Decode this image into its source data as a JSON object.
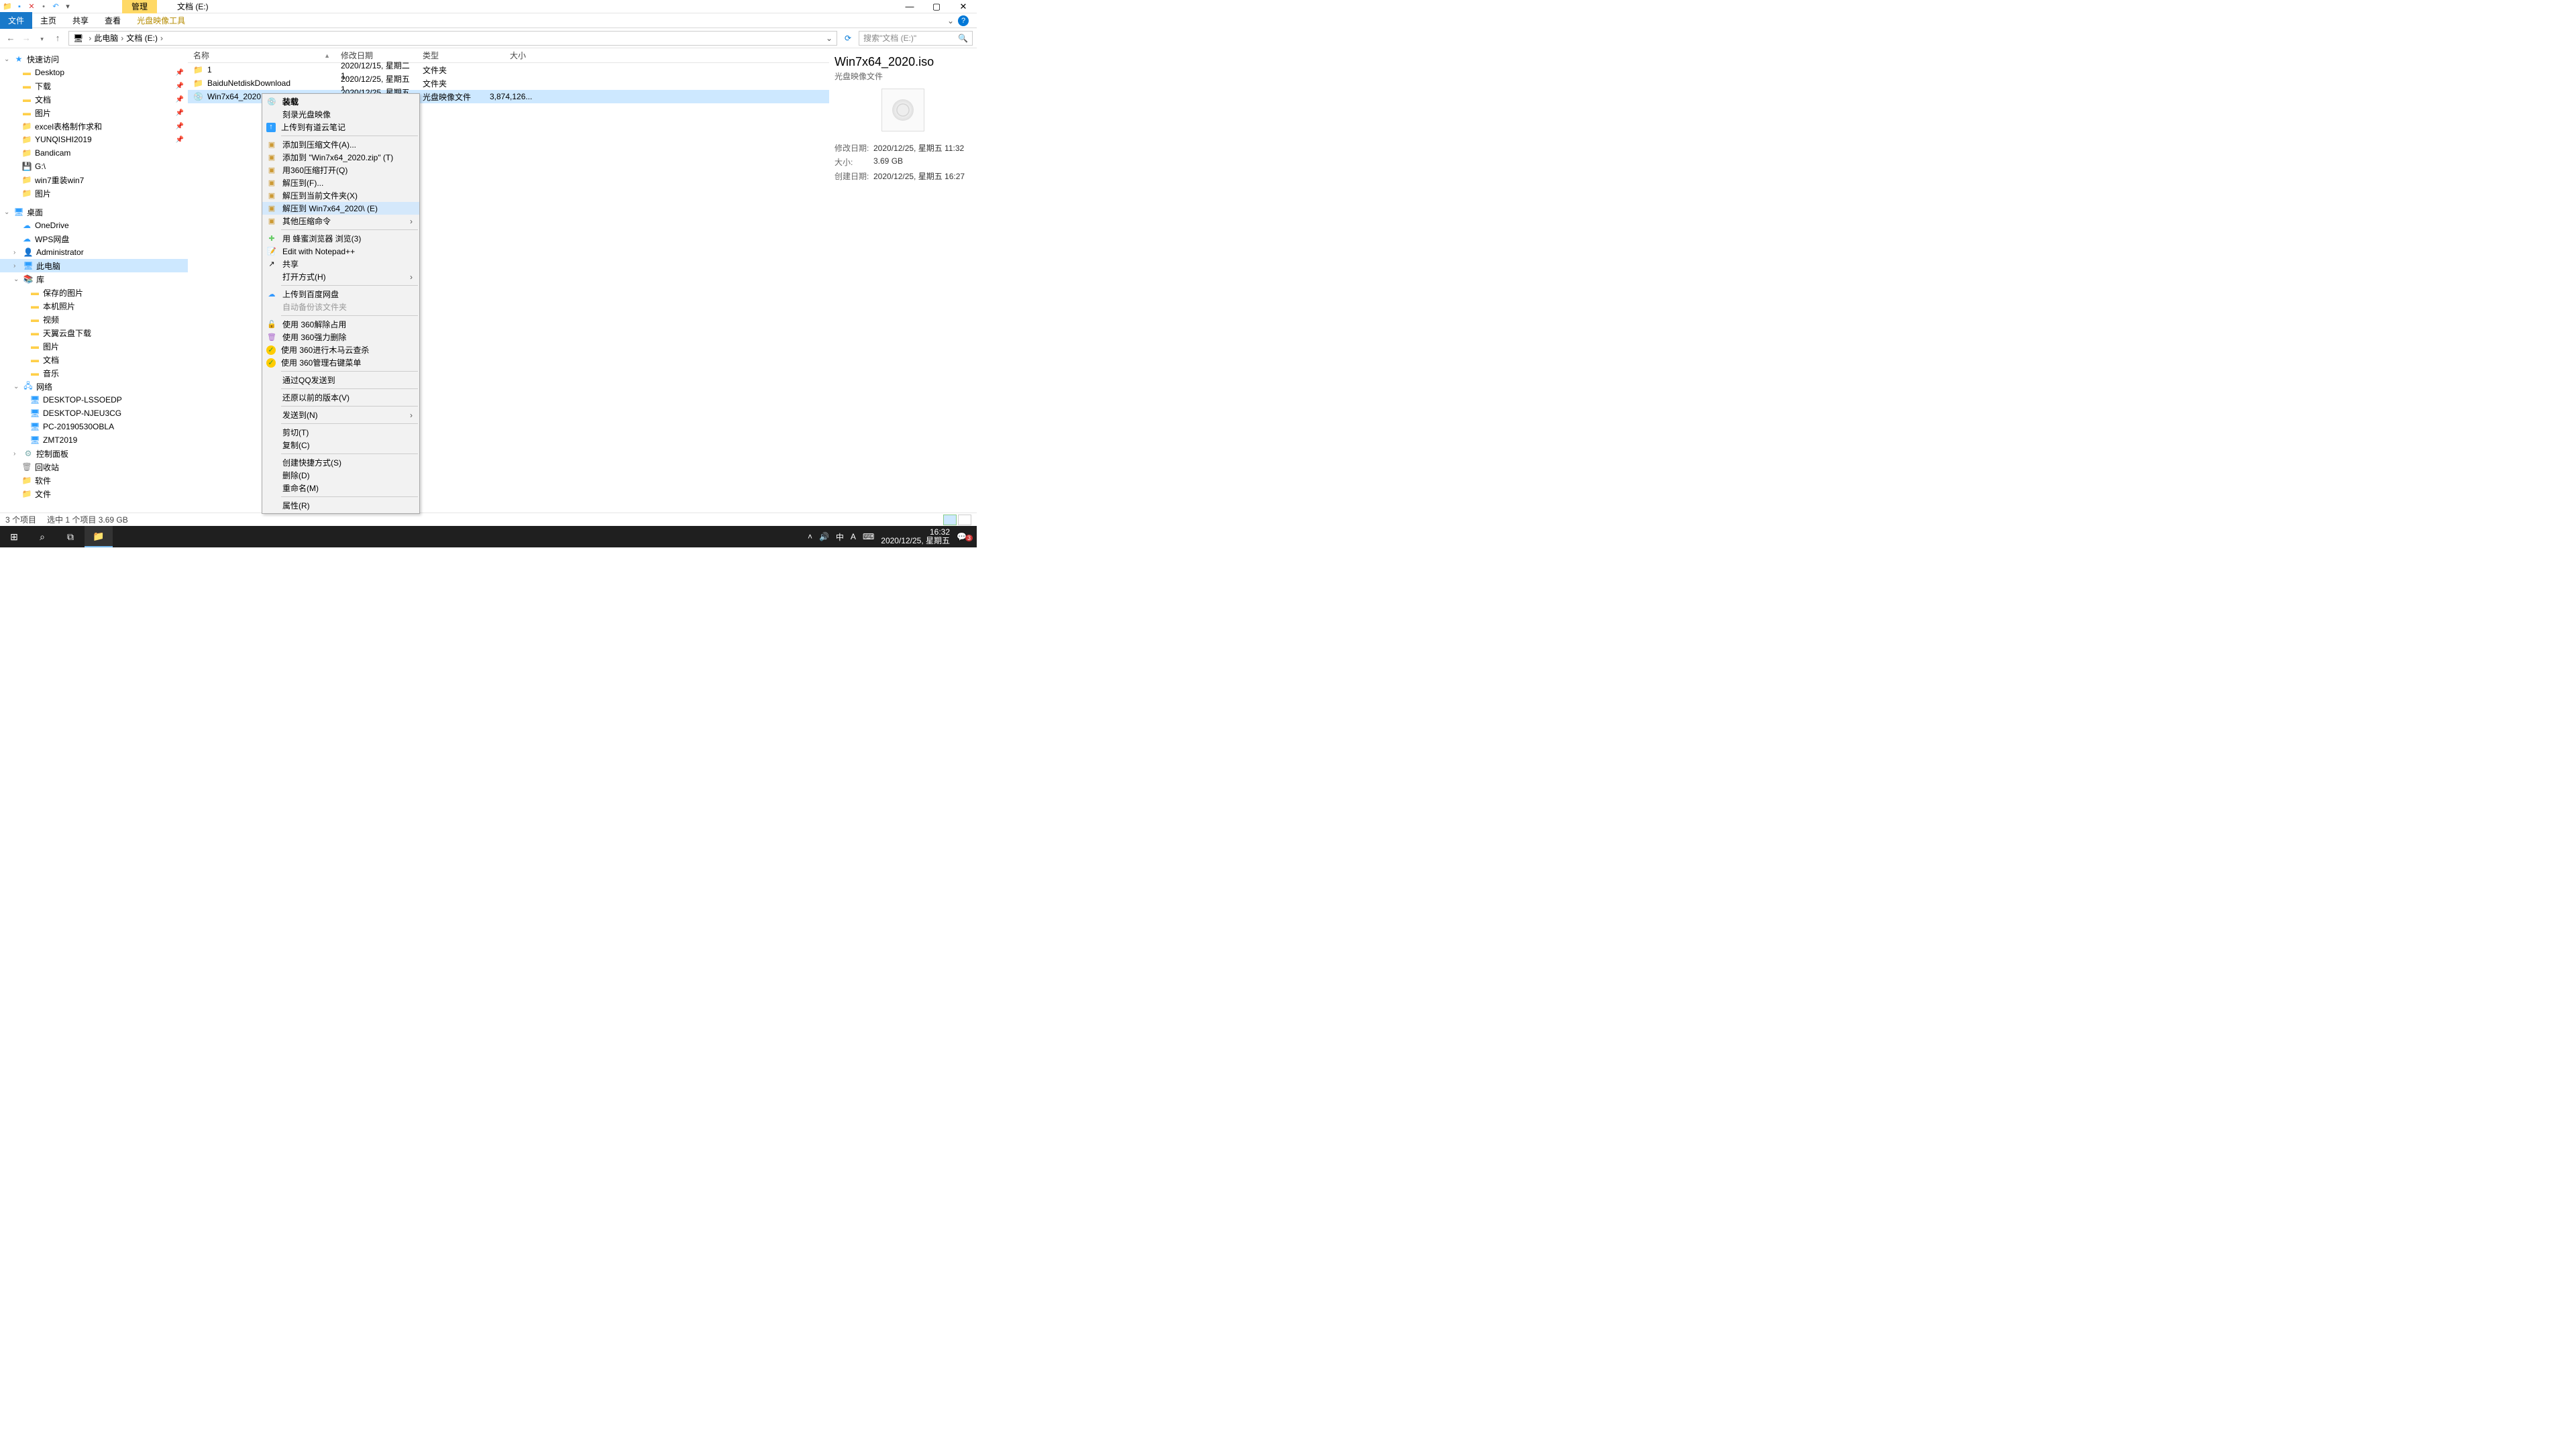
{
  "titlebar": {
    "manage": "管理",
    "location": "文档 (E:)"
  },
  "ribbon": {
    "file": "文件",
    "home": "主页",
    "share": "共享",
    "view": "查看",
    "tools": "光盘映像工具"
  },
  "addr": {
    "crumb1": "此电脑",
    "crumb2": "文档 (E:)",
    "refresh_title": "刷新",
    "search_placeholder": "搜索\"文档 (E:)\""
  },
  "tree": {
    "quick": "快速访问",
    "desktop1": "Desktop",
    "downloads": "下载",
    "docs1": "文档",
    "pics1": "图片",
    "excel": "excel表格制作求和",
    "yunqishi": "YUNQISHI2019",
    "bandicam": "Bandicam",
    "gdrive": "G:\\",
    "win7re": "win7重装win7",
    "pics2": "图片",
    "desktop2": "桌面",
    "onedrive": "OneDrive",
    "wps": "WPS网盘",
    "admin": "Administrator",
    "thispc": "此电脑",
    "lib": "库",
    "savedpics": "保存的图片",
    "localpics": "本机照片",
    "video": "视频",
    "tianyi": "天翼云盘下载",
    "pics3": "图片",
    "docs2": "文档",
    "music": "音乐",
    "network": "网络",
    "net1": "DESKTOP-LSSOEDP",
    "net2": "DESKTOP-NJEU3CG",
    "net3": "PC-20190530OBLA",
    "net4": "ZMT2019",
    "ctrlp": "控制面板",
    "recycle": "回收站",
    "soft": "软件",
    "files": "文件"
  },
  "list": {
    "col_name": "名称",
    "col_date": "修改日期",
    "col_type": "类型",
    "col_size": "大小",
    "rows": [
      {
        "name": "1",
        "date": "2020/12/15, 星期二 1...",
        "type": "文件夹",
        "size": ""
      },
      {
        "name": "BaiduNetdiskDownload",
        "date": "2020/12/25, 星期五 1...",
        "type": "文件夹",
        "size": ""
      },
      {
        "name": "Win7x64_2020.iso",
        "date": "2020/12/25, 星期五 1...",
        "type": "光盘映像文件",
        "size": "3,874,126..."
      }
    ]
  },
  "ctx": {
    "mount": "装载",
    "burn": "刻录光盘映像",
    "youdao": "上传到有道云笔记",
    "addarc": "添加到压缩文件(A)...",
    "addzip": "添加到 \"Win7x64_2020.zip\" (T)",
    "open360": "用360压缩打开(Q)",
    "extractto": "解压到(F)...",
    "extracthere": "解压到当前文件夹(X)",
    "extractdir": "解压到 Win7x64_2020\\ (E)",
    "othercomp": "其他压缩命令",
    "bee": "用 蜂蜜浏览器 浏览(3)",
    "npp": "Edit with Notepad++",
    "share": "共享",
    "openwith": "打开方式(H)",
    "baidu": "上传到百度网盘",
    "autobak": "自动备份该文件夹",
    "unlock360": "使用 360解除占用",
    "forcedel360": "使用 360强力删除",
    "trojan360": "使用 360进行木马云查杀",
    "manage360": "使用 360管理右键菜单",
    "qqsend": "通过QQ发送到",
    "restore": "还原以前的版本(V)",
    "sendto": "发送到(N)",
    "cut": "剪切(T)",
    "copy": "复制(C)",
    "shortcut": "创建快捷方式(S)",
    "delete": "删除(D)",
    "rename": "重命名(M)",
    "props": "属性(R)"
  },
  "details": {
    "title": "Win7x64_2020.iso",
    "type": "光盘映像文件",
    "mdate_k": "修改日期:",
    "mdate_v": "2020/12/25, 星期五 11:32",
    "size_k": "大小:",
    "size_v": "3.69 GB",
    "cdate_k": "创建日期:",
    "cdate_v": "2020/12/25, 星期五 16:27"
  },
  "status": {
    "count": "3 个项目",
    "sel": "选中 1 个项目  3.69 GB"
  },
  "taskbar": {
    "ime1": "中",
    "ime2": "A",
    "time": "16:32",
    "date": "2020/12/25, 星期五",
    "notif_count": "3"
  }
}
